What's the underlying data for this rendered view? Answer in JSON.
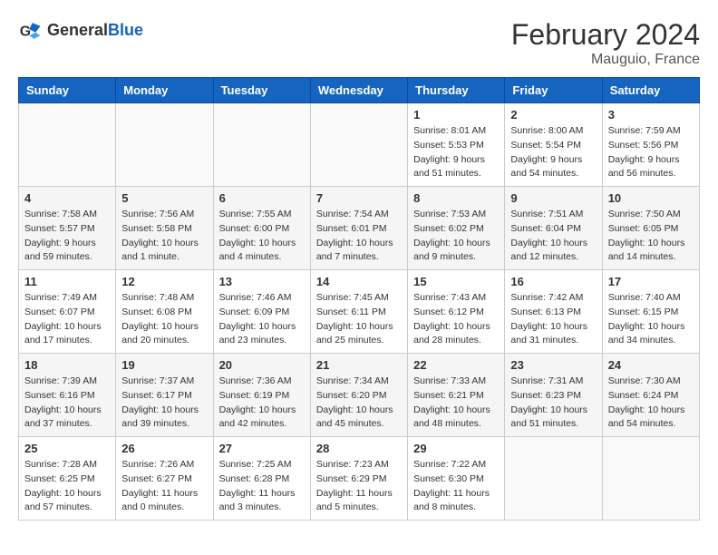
{
  "header": {
    "logo_general": "General",
    "logo_blue": "Blue",
    "month_title": "February 2024",
    "location": "Mauguio, France"
  },
  "days_of_week": [
    "Sunday",
    "Monday",
    "Tuesday",
    "Wednesday",
    "Thursday",
    "Friday",
    "Saturday"
  ],
  "weeks": [
    [
      {
        "day": "",
        "sunrise": "",
        "sunset": "",
        "daylight": "",
        "empty": true
      },
      {
        "day": "",
        "sunrise": "",
        "sunset": "",
        "daylight": "",
        "empty": true
      },
      {
        "day": "",
        "sunrise": "",
        "sunset": "",
        "daylight": "",
        "empty": true
      },
      {
        "day": "",
        "sunrise": "",
        "sunset": "",
        "daylight": "",
        "empty": true
      },
      {
        "day": "1",
        "sunrise": "Sunrise: 8:01 AM",
        "sunset": "Sunset: 5:53 PM",
        "daylight": "Daylight: 9 hours and 51 minutes."
      },
      {
        "day": "2",
        "sunrise": "Sunrise: 8:00 AM",
        "sunset": "Sunset: 5:54 PM",
        "daylight": "Daylight: 9 hours and 54 minutes."
      },
      {
        "day": "3",
        "sunrise": "Sunrise: 7:59 AM",
        "sunset": "Sunset: 5:56 PM",
        "daylight": "Daylight: 9 hours and 56 minutes."
      }
    ],
    [
      {
        "day": "4",
        "sunrise": "Sunrise: 7:58 AM",
        "sunset": "Sunset: 5:57 PM",
        "daylight": "Daylight: 9 hours and 59 minutes."
      },
      {
        "day": "5",
        "sunrise": "Sunrise: 7:56 AM",
        "sunset": "Sunset: 5:58 PM",
        "daylight": "Daylight: 10 hours and 1 minute."
      },
      {
        "day": "6",
        "sunrise": "Sunrise: 7:55 AM",
        "sunset": "Sunset: 6:00 PM",
        "daylight": "Daylight: 10 hours and 4 minutes."
      },
      {
        "day": "7",
        "sunrise": "Sunrise: 7:54 AM",
        "sunset": "Sunset: 6:01 PM",
        "daylight": "Daylight: 10 hours and 7 minutes."
      },
      {
        "day": "8",
        "sunrise": "Sunrise: 7:53 AM",
        "sunset": "Sunset: 6:02 PM",
        "daylight": "Daylight: 10 hours and 9 minutes."
      },
      {
        "day": "9",
        "sunrise": "Sunrise: 7:51 AM",
        "sunset": "Sunset: 6:04 PM",
        "daylight": "Daylight: 10 hours and 12 minutes."
      },
      {
        "day": "10",
        "sunrise": "Sunrise: 7:50 AM",
        "sunset": "Sunset: 6:05 PM",
        "daylight": "Daylight: 10 hours and 14 minutes."
      }
    ],
    [
      {
        "day": "11",
        "sunrise": "Sunrise: 7:49 AM",
        "sunset": "Sunset: 6:07 PM",
        "daylight": "Daylight: 10 hours and 17 minutes."
      },
      {
        "day": "12",
        "sunrise": "Sunrise: 7:48 AM",
        "sunset": "Sunset: 6:08 PM",
        "daylight": "Daylight: 10 hours and 20 minutes."
      },
      {
        "day": "13",
        "sunrise": "Sunrise: 7:46 AM",
        "sunset": "Sunset: 6:09 PM",
        "daylight": "Daylight: 10 hours and 23 minutes."
      },
      {
        "day": "14",
        "sunrise": "Sunrise: 7:45 AM",
        "sunset": "Sunset: 6:11 PM",
        "daylight": "Daylight: 10 hours and 25 minutes."
      },
      {
        "day": "15",
        "sunrise": "Sunrise: 7:43 AM",
        "sunset": "Sunset: 6:12 PM",
        "daylight": "Daylight: 10 hours and 28 minutes."
      },
      {
        "day": "16",
        "sunrise": "Sunrise: 7:42 AM",
        "sunset": "Sunset: 6:13 PM",
        "daylight": "Daylight: 10 hours and 31 minutes."
      },
      {
        "day": "17",
        "sunrise": "Sunrise: 7:40 AM",
        "sunset": "Sunset: 6:15 PM",
        "daylight": "Daylight: 10 hours and 34 minutes."
      }
    ],
    [
      {
        "day": "18",
        "sunrise": "Sunrise: 7:39 AM",
        "sunset": "Sunset: 6:16 PM",
        "daylight": "Daylight: 10 hours and 37 minutes."
      },
      {
        "day": "19",
        "sunrise": "Sunrise: 7:37 AM",
        "sunset": "Sunset: 6:17 PM",
        "daylight": "Daylight: 10 hours and 39 minutes."
      },
      {
        "day": "20",
        "sunrise": "Sunrise: 7:36 AM",
        "sunset": "Sunset: 6:19 PM",
        "daylight": "Daylight: 10 hours and 42 minutes."
      },
      {
        "day": "21",
        "sunrise": "Sunrise: 7:34 AM",
        "sunset": "Sunset: 6:20 PM",
        "daylight": "Daylight: 10 hours and 45 minutes."
      },
      {
        "day": "22",
        "sunrise": "Sunrise: 7:33 AM",
        "sunset": "Sunset: 6:21 PM",
        "daylight": "Daylight: 10 hours and 48 minutes."
      },
      {
        "day": "23",
        "sunrise": "Sunrise: 7:31 AM",
        "sunset": "Sunset: 6:23 PM",
        "daylight": "Daylight: 10 hours and 51 minutes."
      },
      {
        "day": "24",
        "sunrise": "Sunrise: 7:30 AM",
        "sunset": "Sunset: 6:24 PM",
        "daylight": "Daylight: 10 hours and 54 minutes."
      }
    ],
    [
      {
        "day": "25",
        "sunrise": "Sunrise: 7:28 AM",
        "sunset": "Sunset: 6:25 PM",
        "daylight": "Daylight: 10 hours and 57 minutes."
      },
      {
        "day": "26",
        "sunrise": "Sunrise: 7:26 AM",
        "sunset": "Sunset: 6:27 PM",
        "daylight": "Daylight: 11 hours and 0 minutes."
      },
      {
        "day": "27",
        "sunrise": "Sunrise: 7:25 AM",
        "sunset": "Sunset: 6:28 PM",
        "daylight": "Daylight: 11 hours and 3 minutes."
      },
      {
        "day": "28",
        "sunrise": "Sunrise: 7:23 AM",
        "sunset": "Sunset: 6:29 PM",
        "daylight": "Daylight: 11 hours and 5 minutes."
      },
      {
        "day": "29",
        "sunrise": "Sunrise: 7:22 AM",
        "sunset": "Sunset: 6:30 PM",
        "daylight": "Daylight: 11 hours and 8 minutes."
      },
      {
        "day": "",
        "sunrise": "",
        "sunset": "",
        "daylight": "",
        "empty": true
      },
      {
        "day": "",
        "sunrise": "",
        "sunset": "",
        "daylight": "",
        "empty": true
      }
    ]
  ]
}
